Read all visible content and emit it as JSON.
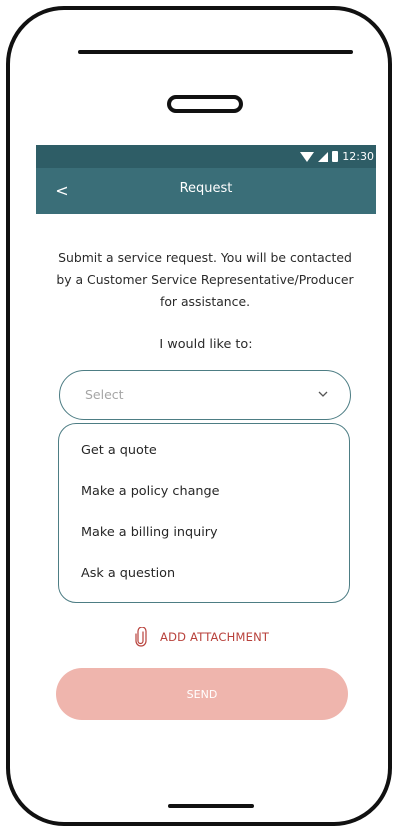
{
  "status_bar": {
    "time": "12:30"
  },
  "header": {
    "title": "Request",
    "back_label": "<"
  },
  "description": "Submit a service request. You will be contacted by a Customer Service Representative/Producer for assistance.",
  "prompt": "I would like to:",
  "select": {
    "placeholder": "Select",
    "options": [
      "Get a quote",
      "Make a policy change",
      "Make a billing inquiry",
      "Ask a question"
    ]
  },
  "attachment": {
    "label": "ADD ATTACHMENT",
    "icon": "paperclip-icon"
  },
  "send_button": {
    "label": "SEND"
  },
  "colors": {
    "status_bar": "#2e5d66",
    "app_bar": "#3a6e78",
    "accent_red": "#b8413b",
    "send_disabled": "#efb5ad",
    "field_border": "#4d7d84"
  }
}
